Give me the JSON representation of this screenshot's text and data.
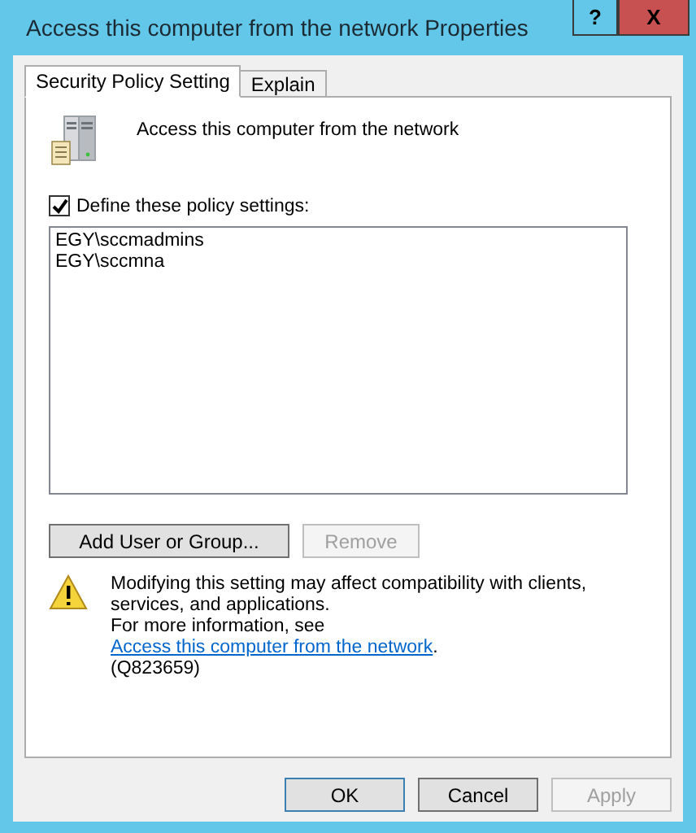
{
  "window": {
    "title": "Access this computer from the network Properties",
    "help_glyph": "?",
    "close_glyph": "X"
  },
  "tabs": [
    {
      "label": "Security Policy Setting",
      "selected": true
    },
    {
      "label": "Explain",
      "selected": false
    }
  ],
  "policy": {
    "name": "Access this computer from the network"
  },
  "define_checkbox": {
    "label": "Define these policy settings:",
    "checked": true
  },
  "accounts": [
    "EGY\\sccmadmins",
    "EGY\\sccmna"
  ],
  "list_buttons": [
    {
      "label": "Add User or Group...",
      "disabled": false
    },
    {
      "label": "Remove",
      "disabled": true
    }
  ],
  "warning": {
    "text": "Modifying this setting may affect compatibility with clients, services, and applications.",
    "more_prefix": "For more information, see ",
    "link": "Access this computer from the network",
    "more_suffix": ".",
    "reference": "(Q823659)"
  },
  "dialog_buttons": [
    {
      "label": "OK",
      "default": true,
      "disabled": false
    },
    {
      "label": "Cancel",
      "default": false,
      "disabled": false
    },
    {
      "label": "Apply",
      "default": false,
      "disabled": true
    }
  ]
}
